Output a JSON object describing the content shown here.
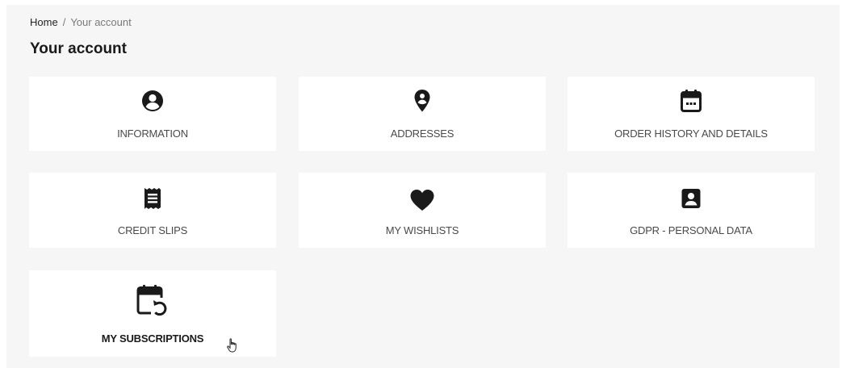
{
  "breadcrumb": {
    "home": "Home",
    "separator": "/",
    "current": "Your account"
  },
  "page": {
    "title": "Your account"
  },
  "tiles": [
    {
      "label": "INFORMATION",
      "icon": "user-circle-icon"
    },
    {
      "label": "ADDRESSES",
      "icon": "map-pin-icon"
    },
    {
      "label": "ORDER HISTORY AND DETAILS",
      "icon": "calendar-icon"
    },
    {
      "label": "CREDIT SLIPS",
      "icon": "receipt-icon"
    },
    {
      "label": "MY WISHLISTS",
      "icon": "heart-icon"
    },
    {
      "label": "GDPR - PERSONAL DATA",
      "icon": "contact-card-icon"
    },
    {
      "label": "MY SUBSCRIPTIONS",
      "icon": "calendar-refresh-icon"
    }
  ],
  "colors": {
    "background": "#f6f6f6",
    "tile": "#ffffff",
    "icon": "#1a1a1a",
    "label": "#4a4a4a"
  }
}
